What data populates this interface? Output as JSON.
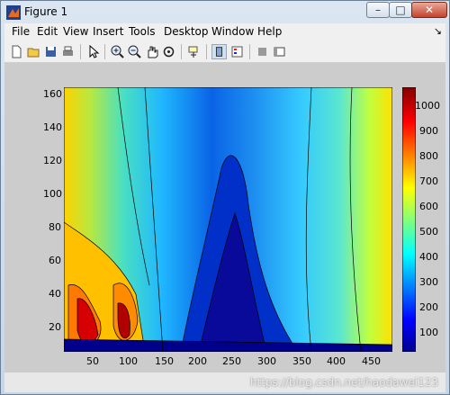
{
  "window": {
    "title": "Figure 1",
    "min": "–",
    "max": "□",
    "close": "✕"
  },
  "menu": [
    "File",
    "Edit",
    "View",
    "Insert",
    "Tools",
    "Desktop",
    "Window",
    "Help"
  ],
  "menu_arrow": "↘",
  "toolbar": [
    "new-figure-icon",
    "open-file-icon",
    "save-icon",
    "print-icon",
    "edit-plot-icon",
    "zoom-in-icon",
    "zoom-out-icon",
    "pan-icon",
    "rotate-3d-icon",
    "data-cursor-icon",
    "plot-tools-icon",
    "insert-legend-icon",
    "hide-plot-tools-icon",
    "show-plot-tools-icon"
  ],
  "x_ticks": [
    "50",
    "100",
    "150",
    "200",
    "250",
    "300",
    "350",
    "400",
    "450"
  ],
  "y_ticks": [
    "20",
    "40",
    "60",
    "80",
    "100",
    "120",
    "140",
    "160"
  ],
  "cb_ticks": [
    "100",
    "200",
    "300",
    "400",
    "500",
    "600",
    "700",
    "800",
    "900",
    "1000"
  ],
  "watermark": "https://blog.csdn.net/haodawei123",
  "colors": {
    "frame": "#6b7f95",
    "figure_bg": "#cccccc",
    "close_btn": "#c2432c"
  }
}
